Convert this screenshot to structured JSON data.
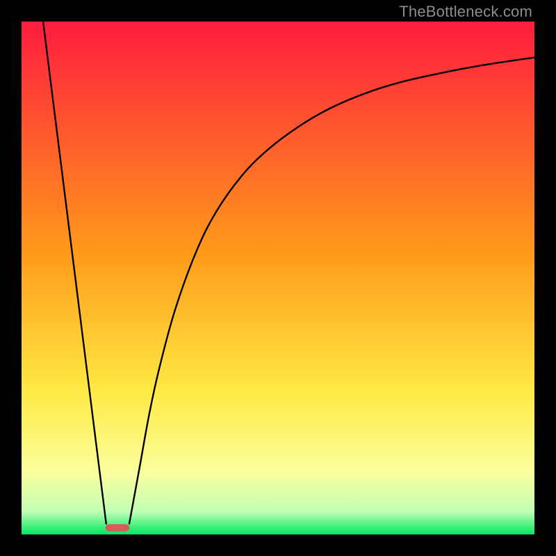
{
  "watermark": "TheBottleneck.com",
  "chart_data": {
    "type": "line",
    "title": "",
    "xlabel": "",
    "ylabel": "",
    "xlim": [
      0,
      100
    ],
    "ylim": [
      0,
      100
    ],
    "grid": false,
    "legend": false,
    "background_gradient": {
      "stops": [
        {
          "pos": 0.0,
          "color": "#ff1c3f"
        },
        {
          "pos": 0.45,
          "color": "#ff9a1a"
        },
        {
          "pos": 0.72,
          "color": "#ffe943"
        },
        {
          "pos": 0.88,
          "color": "#faff9e"
        },
        {
          "pos": 0.955,
          "color": "#c1ffb4"
        },
        {
          "pos": 1.0,
          "color": "#00e763"
        }
      ]
    },
    "series": [
      {
        "name": "left-descent",
        "type": "line",
        "x": [
          4.2,
          16.5
        ],
        "y": [
          100,
          2.1
        ]
      },
      {
        "name": "right-curve",
        "type": "line",
        "x": [
          21.0,
          23,
          25,
          27,
          30,
          34,
          38,
          43,
          48,
          54,
          60,
          67,
          74,
          82,
          90,
          100
        ],
        "y": [
          2.1,
          13,
          24,
          33,
          44,
          55,
          63,
          70,
          75,
          79.5,
          83,
          86,
          88.2,
          90,
          91.5,
          93
        ]
      }
    ],
    "marker": {
      "name": "valley-marker",
      "x": 18.7,
      "y": 1.3,
      "width_pct": 4.7,
      "height_pct": 1.4,
      "color": "#d85a5a"
    }
  }
}
